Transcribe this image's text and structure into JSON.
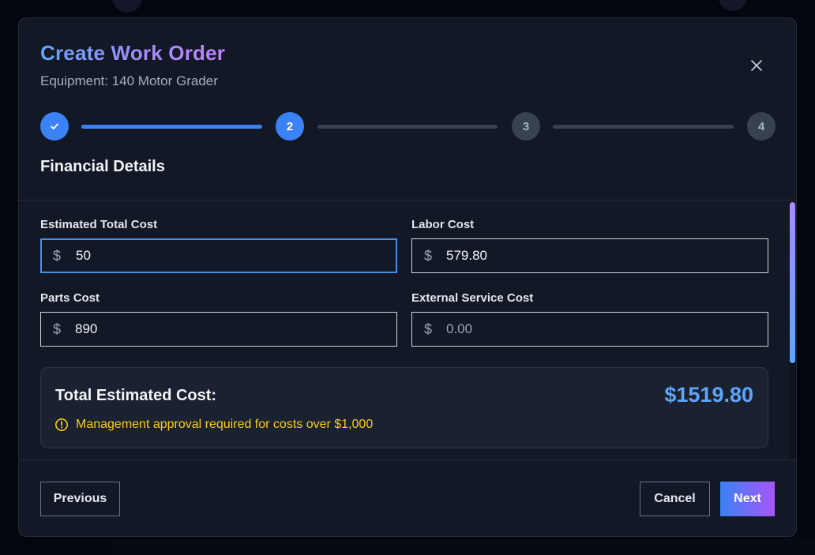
{
  "modal": {
    "title": "Create Work Order",
    "subtitle": "Equipment: 140 Motor Grader",
    "close_icon": "close-icon"
  },
  "stepper": {
    "current_step": 2,
    "steps": [
      {
        "label": "1",
        "state": "complete",
        "icon": "check-icon"
      },
      {
        "label": "2",
        "state": "active"
      },
      {
        "label": "3",
        "state": "pending"
      },
      {
        "label": "4",
        "state": "pending"
      }
    ]
  },
  "section": {
    "title": "Financial Details"
  },
  "fields": {
    "estimated_total_cost": {
      "label": "Estimated Total Cost",
      "currency": "$",
      "value": "50",
      "placeholder": ""
    },
    "labor_cost": {
      "label": "Labor Cost",
      "currency": "$",
      "value": "579.80",
      "placeholder": ""
    },
    "parts_cost": {
      "label": "Parts Cost",
      "currency": "$",
      "value": "890",
      "placeholder": ""
    },
    "external_service_cost": {
      "label": "External Service Cost",
      "currency": "$",
      "value": "",
      "placeholder": "0.00"
    }
  },
  "summary": {
    "label": "Total Estimated Cost:",
    "value": "$1519.80",
    "warning_icon": "alert-circle-icon",
    "warning": "Management approval required for costs over $1,000"
  },
  "footer": {
    "previous_label": "Previous",
    "cancel_label": "Cancel",
    "next_label": "Next"
  },
  "colors": {
    "accent": "#3b82f6",
    "total_value": "#60a5fa",
    "warning": "#facc15",
    "modal_bg": "#121826"
  }
}
